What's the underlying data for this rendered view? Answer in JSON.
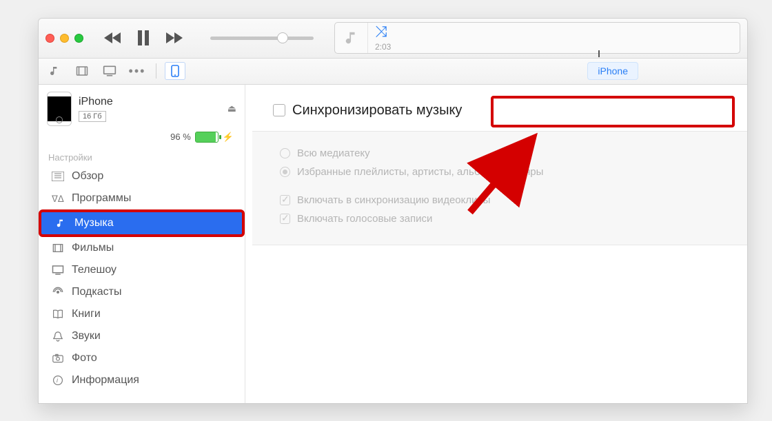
{
  "playback": {
    "timecode": "2:03"
  },
  "tabbar": {
    "pill": "iPhone"
  },
  "device": {
    "name": "iPhone",
    "storage": "16 Гб",
    "battery_pct": "96 %"
  },
  "sidebar": {
    "settings_header": "Настройки",
    "items": [
      {
        "icon": "summary",
        "label": "Обзор"
      },
      {
        "icon": "apps",
        "label": "Программы"
      },
      {
        "icon": "music",
        "label": "Музыка",
        "selected": true,
        "highlighted": true
      },
      {
        "icon": "movies",
        "label": "Фильмы"
      },
      {
        "icon": "tv",
        "label": "Телешоу"
      },
      {
        "icon": "podcasts",
        "label": "Подкасты"
      },
      {
        "icon": "books",
        "label": "Книги"
      },
      {
        "icon": "tones",
        "label": "Звуки"
      },
      {
        "icon": "photos",
        "label": "Фото"
      },
      {
        "icon": "info",
        "label": "Информация"
      }
    ]
  },
  "content": {
    "sync_label": "Синхронизировать музыку",
    "radio_all": "Всю медиатеку",
    "radio_selected": "Избранные плейлисты, артисты, альбомы и жанры",
    "chk_videos": "Включать в синхронизацию видеоклипы",
    "chk_voice": "Включать голосовые записи"
  }
}
